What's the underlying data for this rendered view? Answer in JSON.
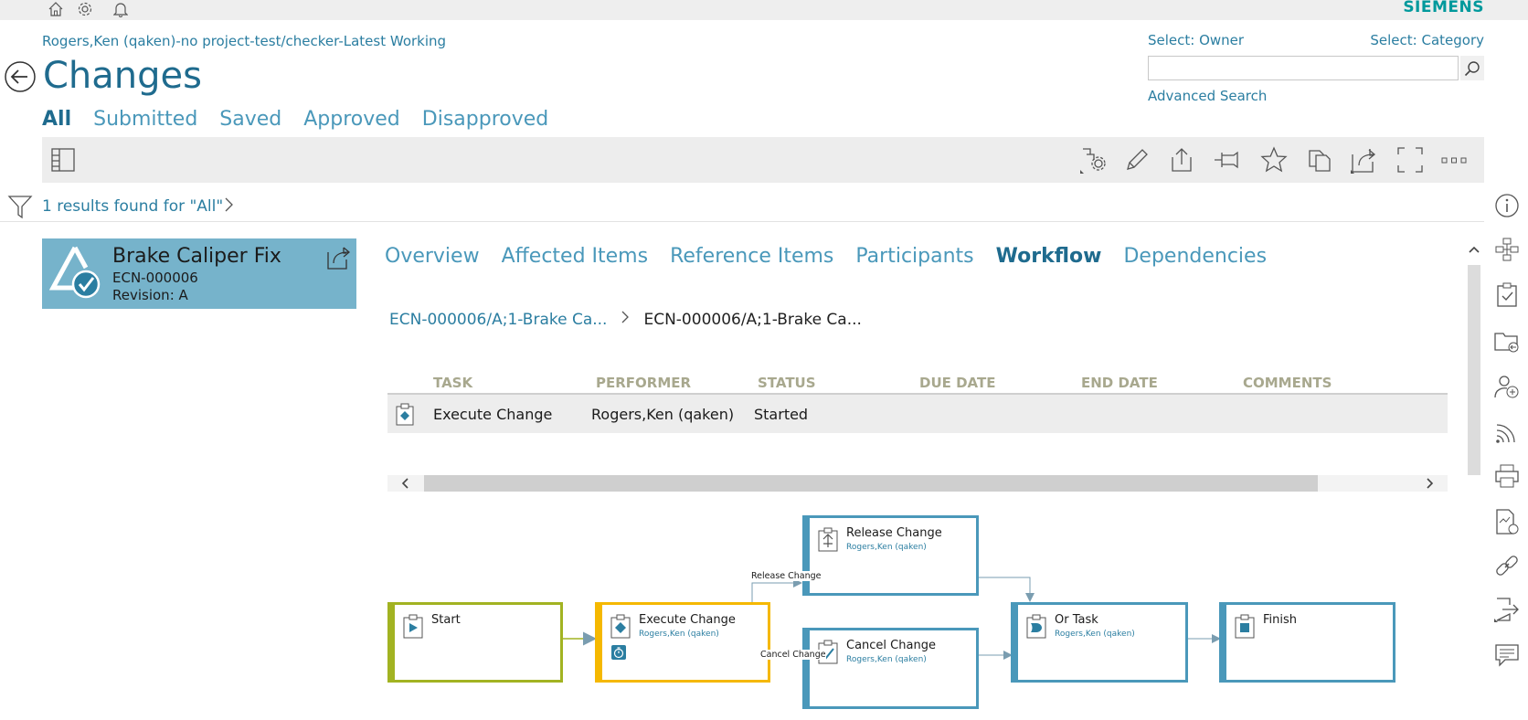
{
  "brand": "SIEMENS",
  "context": {
    "breadcrumb": "Rogers,Ken (qaken)-no project-test/checker-Latest Working",
    "page_title": "Changes"
  },
  "search": {
    "owner_label": "Select: Owner",
    "category_label": "Select: Category",
    "placeholder": "",
    "advanced_label": "Advanced Search"
  },
  "filter_tabs": [
    {
      "label": "All",
      "active": true
    },
    {
      "label": "Submitted"
    },
    {
      "label": "Saved"
    },
    {
      "label": "Approved"
    },
    {
      "label": "Disapproved"
    }
  ],
  "results": {
    "text": "1 results found for \"All\""
  },
  "card": {
    "title": "Brake Caliper Fix",
    "id": "ECN-000006",
    "revision": "Revision:  A"
  },
  "object_tabs": [
    {
      "label": "Overview"
    },
    {
      "label": "Affected Items"
    },
    {
      "label": "Reference Items"
    },
    {
      "label": "Participants"
    },
    {
      "label": "Workflow",
      "active": true
    },
    {
      "label": "Dependencies"
    }
  ],
  "workflow_crumbs": {
    "parent": "ECN-000006/A;1-Brake Ca...",
    "current": "ECN-000006/A;1-Brake Ca..."
  },
  "task_table": {
    "headers": {
      "task": "TASK",
      "performer": "PERFORMER",
      "status": "STATUS",
      "due_date": "DUE DATE",
      "end_date": "END DATE",
      "comments": "COMMENTS"
    },
    "rows": [
      {
        "task": "Execute Change",
        "performer": "Rogers,Ken (qaken)",
        "status": "Started",
        "due_date": "",
        "end_date": "",
        "comments": ""
      }
    ]
  },
  "diagram": {
    "nodes": {
      "start": {
        "title": "Start"
      },
      "execute": {
        "title": "Execute Change",
        "performer": "Rogers,Ken (qaken)"
      },
      "release": {
        "title": "Release Change",
        "performer": "Rogers,Ken (qaken)"
      },
      "cancel": {
        "title": "Cancel Change",
        "performer": "Rogers,Ken (qaken)"
      },
      "or_task": {
        "title": "Or Task",
        "performer": "Rogers,Ken (qaken)"
      },
      "finish": {
        "title": "Finish"
      }
    },
    "edge_labels": {
      "release": "Release Change",
      "cancel": "Cancel Change"
    }
  },
  "colors": {
    "accent": "#2b7ea1",
    "brand": "#00999c",
    "card_bg": "#76b3cb",
    "start_border": "#a2b322",
    "active_border": "#f5b800",
    "node_border": "#4a98ba"
  },
  "icons": {
    "topbar": [
      "home-icon",
      "gear-icon",
      "bell-icon"
    ],
    "toolbar": [
      "layout-panel-icon",
      "workflow-settings-icon",
      "edit-icon",
      "export-icon",
      "pin-icon",
      "favorite-icon",
      "copy-icon",
      "share-icon",
      "fullscreen-icon",
      "more-icon"
    ],
    "right_rail": [
      "info-icon",
      "structure-icon",
      "checklist-icon",
      "folder-icon",
      "user-manage-icon",
      "subscribe-icon",
      "print-icon",
      "report-icon",
      "link-icon",
      "logout-icon",
      "comment-icon"
    ]
  }
}
